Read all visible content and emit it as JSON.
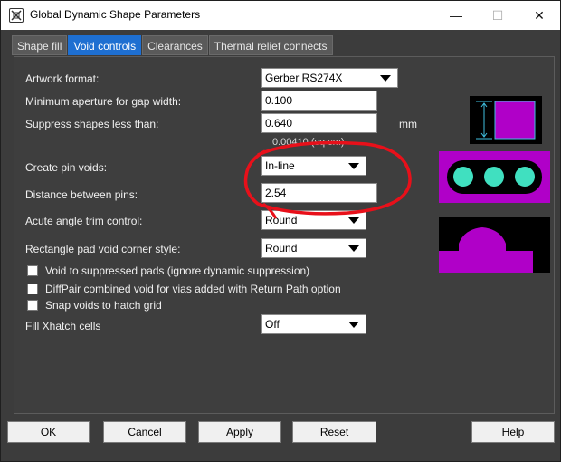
{
  "window": {
    "title": "Global Dynamic Shape Parameters",
    "controls": {
      "minimize": "—",
      "maximize": "☐",
      "close": "✕"
    }
  },
  "tabs": [
    {
      "label": "Shape fill",
      "active": false
    },
    {
      "label": "Void controls",
      "active": true
    },
    {
      "label": "Clearances",
      "active": false
    },
    {
      "label": "Thermal relief connects",
      "active": false
    }
  ],
  "form": {
    "artwork_format": {
      "label": "Artwork format:",
      "value": "Gerber RS274X"
    },
    "min_aperture": {
      "label": "Minimum aperture for gap width:",
      "value": "0.100"
    },
    "suppress_shapes": {
      "label": "Suppress shapes less than:",
      "value": "0.640",
      "unit": "mm",
      "note": "0.00410 (sq cm)"
    },
    "create_pin_voids": {
      "label": "Create pin voids:",
      "value": "In-line"
    },
    "distance_between_pins": {
      "label": "Distance between pins:",
      "value": "2.54"
    },
    "acute_angle": {
      "label": "Acute angle trim control:",
      "value": "Round"
    },
    "rect_pad_void": {
      "label": "Rectangle pad void corner style:",
      "value": "Round"
    },
    "checkboxes": [
      {
        "label": "Void to suppressed pads (ignore dynamic suppression)",
        "checked": false
      },
      {
        "label": "DiffPair combined void for vias added with Return Path option",
        "checked": false
      },
      {
        "label": "Snap voids to hatch grid",
        "checked": false
      }
    ],
    "fill_xhatch": {
      "label": "Fill Xhatch cells",
      "value": "Off"
    }
  },
  "buttons": {
    "ok": "OK",
    "cancel": "Cancel",
    "apply": "Apply",
    "reset": "Reset",
    "help": "Help"
  },
  "colors": {
    "accent": "#1e6fd1",
    "annotation": "#e8101a",
    "preview_fill": "#b000c8",
    "pad": "#40e0c0"
  }
}
